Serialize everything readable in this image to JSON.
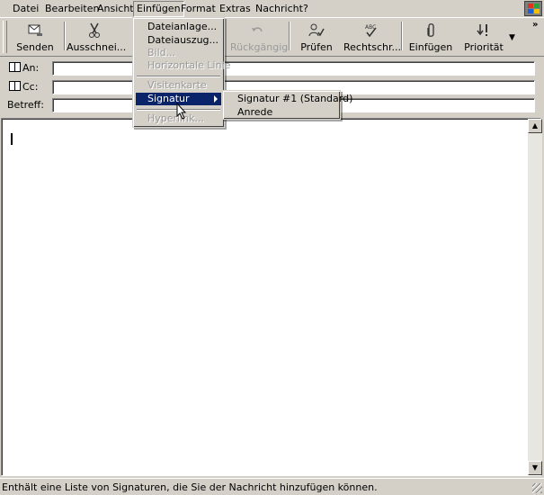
{
  "menubar": {
    "items": [
      "Datei",
      "Bearbeiten",
      "Ansicht",
      "Einfügen",
      "Format",
      "Extras",
      "Nachricht",
      "?"
    ],
    "active": "Einfügen"
  },
  "toolbar": {
    "send": "Senden",
    "cut": "Ausschnei...",
    "undo": "Rückgängig",
    "check": "Prüfen",
    "spelling": "Rechtschr...",
    "attach": "Einfügen",
    "priority": "Priorität"
  },
  "fields": {
    "to_label": "An:",
    "cc_label": "Cc:",
    "subject_label": "Betreff:",
    "to_value": "",
    "cc_value": "",
    "subject_value": ""
  },
  "insert_menu": {
    "items": [
      {
        "label": "Dateianlage...",
        "disabled": false
      },
      {
        "label": "Dateiauszug...",
        "disabled": false
      },
      {
        "label": "Bild...",
        "disabled": true
      },
      {
        "label": "Horizontale Linie",
        "disabled": true
      },
      {
        "label": "Visitenkarte",
        "disabled": true
      },
      {
        "label": "Signatur",
        "disabled": false,
        "highlighted": true,
        "submenu": true
      },
      {
        "label": "Hyperlink...",
        "disabled": true
      }
    ]
  },
  "signature_submenu": {
    "items": [
      "Signatur #1 (Standard)",
      "Anrede"
    ]
  },
  "statusbar": {
    "text": "Enthält eine Liste von Signaturen, die Sie der Nachricht hinzufügen können."
  },
  "colors": {
    "highlight": "#0a246a",
    "face": "#d4d0c8"
  }
}
